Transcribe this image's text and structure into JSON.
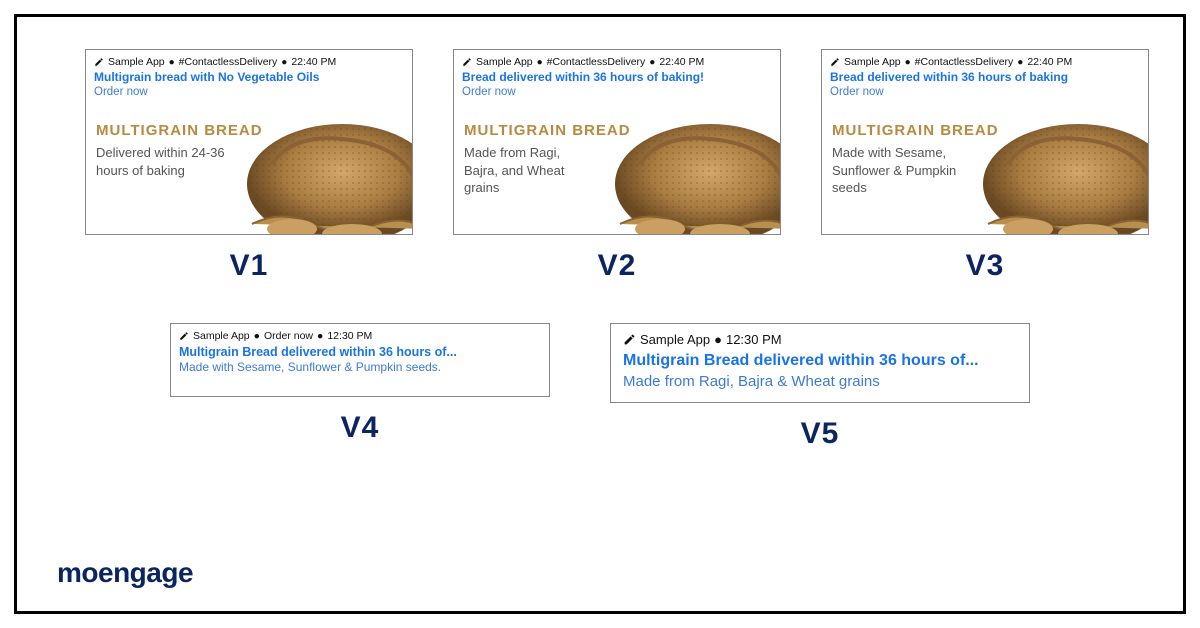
{
  "common": {
    "app_name": "Sample App",
    "tag": "#ContactlessDelivery",
    "time": "22:40 PM",
    "hero_title": "MULTIGRAIN BREAD"
  },
  "v1": {
    "label": "V1",
    "title": "Multigrain bread with No Vegetable Oils",
    "subtitle": "Order now",
    "hero_sub": "Delivered within 24-36 hours of baking"
  },
  "v2": {
    "label": "V2",
    "title": "Bread delivered within 36 hours of baking!",
    "subtitle": "Order now",
    "hero_sub": "Made from Ragi, Bajra, and Wheat grains"
  },
  "v3": {
    "label": "V3",
    "title": "Bread delivered within 36 hours of baking",
    "subtitle": "Order now",
    "hero_sub": "Made with Sesame, Sunflower & Pumpkin seeds"
  },
  "v4": {
    "label": "V4",
    "meta_mid": "Order now",
    "time": "12:30 PM",
    "title": "Multigrain Bread delivered within 36 hours of...",
    "sub": "Made with Sesame, Sunflower & Pumpkin seeds."
  },
  "v5": {
    "label": "V5",
    "time": "12:30 PM",
    "title": "Multigrain Bread delivered within 36 hours of...",
    "sub": "Made from Ragi, Bajra & Wheat grains"
  },
  "brand": "moengage"
}
